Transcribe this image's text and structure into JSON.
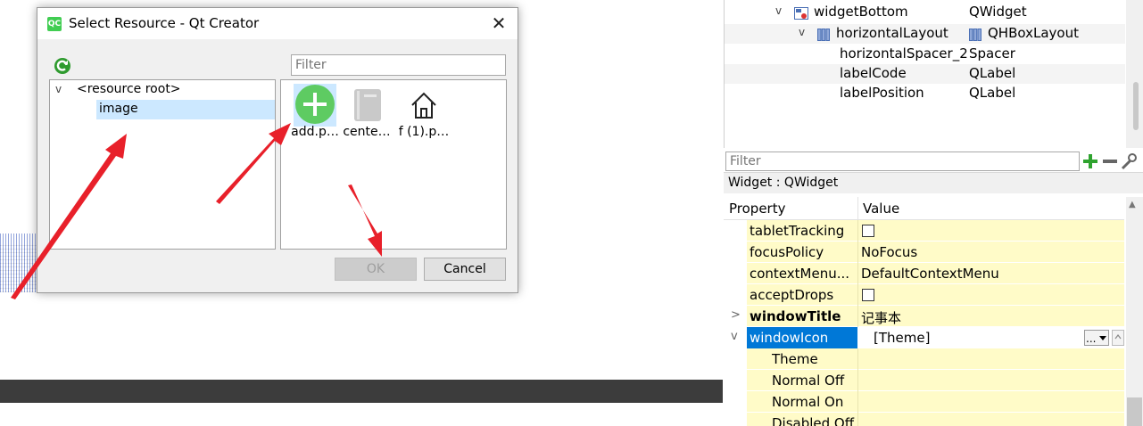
{
  "dialog": {
    "title": "Select Resource - Qt Creator",
    "filter_placeholder": "Filter",
    "tree": {
      "root": "<resource root>",
      "child": "image"
    },
    "files": [
      {
        "label": "add.p…",
        "icon": "add-circle-icon"
      },
      {
        "label": "cente…",
        "icon": "document-icon"
      },
      {
        "label": "f (1).p…",
        "icon": "home-icon"
      }
    ],
    "ok_label": "OK",
    "cancel_label": "Cancel"
  },
  "object_inspector": {
    "rows": [
      {
        "name": "widgetBottom",
        "class": "QWidget"
      },
      {
        "name": "horizontalLayout",
        "class": "QHBoxLayout"
      },
      {
        "name": "horizontalSpacer_2",
        "class": "Spacer"
      },
      {
        "name": "labelCode",
        "class": "QLabel"
      },
      {
        "name": "labelPosition",
        "class": "QLabel"
      }
    ]
  },
  "property_editor": {
    "filter_placeholder": "Filter",
    "widget_class": "Widget : QWidget",
    "col_property": "Property",
    "col_value": "Value",
    "rows": [
      {
        "name": "tabletTracking",
        "value": ""
      },
      {
        "name": "focusPolicy",
        "value": "NoFocus"
      },
      {
        "name": "contextMenu...",
        "value": "DefaultContextMenu"
      },
      {
        "name": "acceptDrops",
        "value": ""
      },
      {
        "name": "windowTitle",
        "value": "记事本"
      },
      {
        "name": "windowIcon",
        "value": "[Theme]"
      },
      {
        "name": "Theme",
        "value": ""
      },
      {
        "name": "Normal Off",
        "value": ""
      },
      {
        "name": "Normal On",
        "value": ""
      },
      {
        "name": "Disabled Off",
        "value": ""
      }
    ],
    "icon_button_label": "..."
  },
  "colors": {
    "accent": "#0078d7",
    "arrow": "#e8202a",
    "property_yellow": "#fffbc8",
    "selection": "#cce8ff",
    "add_green": "#5ecb62"
  }
}
